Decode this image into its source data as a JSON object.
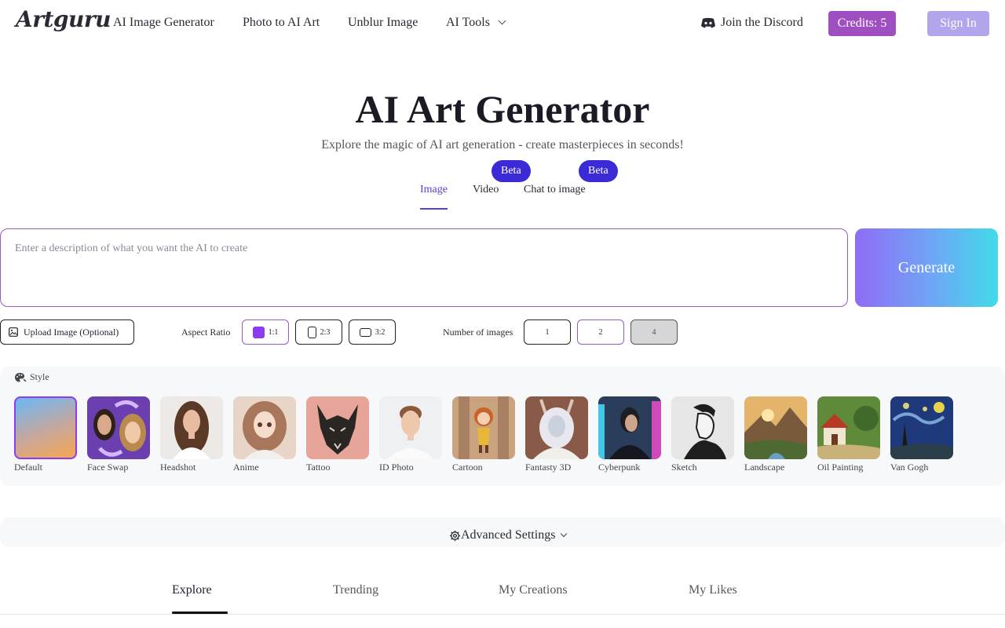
{
  "header": {
    "logo": "Artguru",
    "nav": [
      "AI Image Generator",
      "Photo to AI Art",
      "Unblur Image",
      "AI Tools"
    ],
    "discord": "Join the Discord",
    "credits": "Credits: 5",
    "signin": "Sign In"
  },
  "hero": {
    "title": "AI Art Generator",
    "subtitle": "Explore the magic of AI art generation - create masterpieces in seconds!"
  },
  "modes": {
    "tabs": [
      "Image",
      "Video",
      "Chat to image"
    ],
    "active": "Image",
    "beta_label": "Beta"
  },
  "prompt": {
    "placeholder": "Enter a description of what you want the AI to create",
    "generate": "Generate"
  },
  "options": {
    "upload": "Upload Image (Optional)",
    "aspect_label": "Aspect Ratio",
    "ratios": [
      "1:1",
      "2:3",
      "3:2"
    ],
    "selected_ratio": "1:1",
    "num_label": "Number of images",
    "nums": [
      "1",
      "2",
      "4"
    ],
    "selected_num": "2",
    "disabled_num": "4"
  },
  "style": {
    "heading": "Style",
    "items": [
      "Default",
      "Face Swap",
      "Headshot",
      "Anime",
      "Tattoo",
      "ID Photo",
      "Cartoon",
      "Fantasty 3D",
      "Cyberpunk",
      "Sketch",
      "Landscape",
      "Oil Painting",
      "Van Gogh"
    ],
    "selected": "Default"
  },
  "advanced": {
    "label": "Advanced Settings"
  },
  "bottom_tabs": {
    "tabs": [
      " Explore",
      " Trending",
      " My Creations",
      " My Likes"
    ],
    "active": " Explore"
  },
  "colors": {
    "accent": "#5b3fd6",
    "credits_bg": "#a04fc1",
    "signin_bg": "#b4a4ec",
    "beta_bg": "#3b2bd6",
    "selected_border": "#8b3cf0"
  }
}
